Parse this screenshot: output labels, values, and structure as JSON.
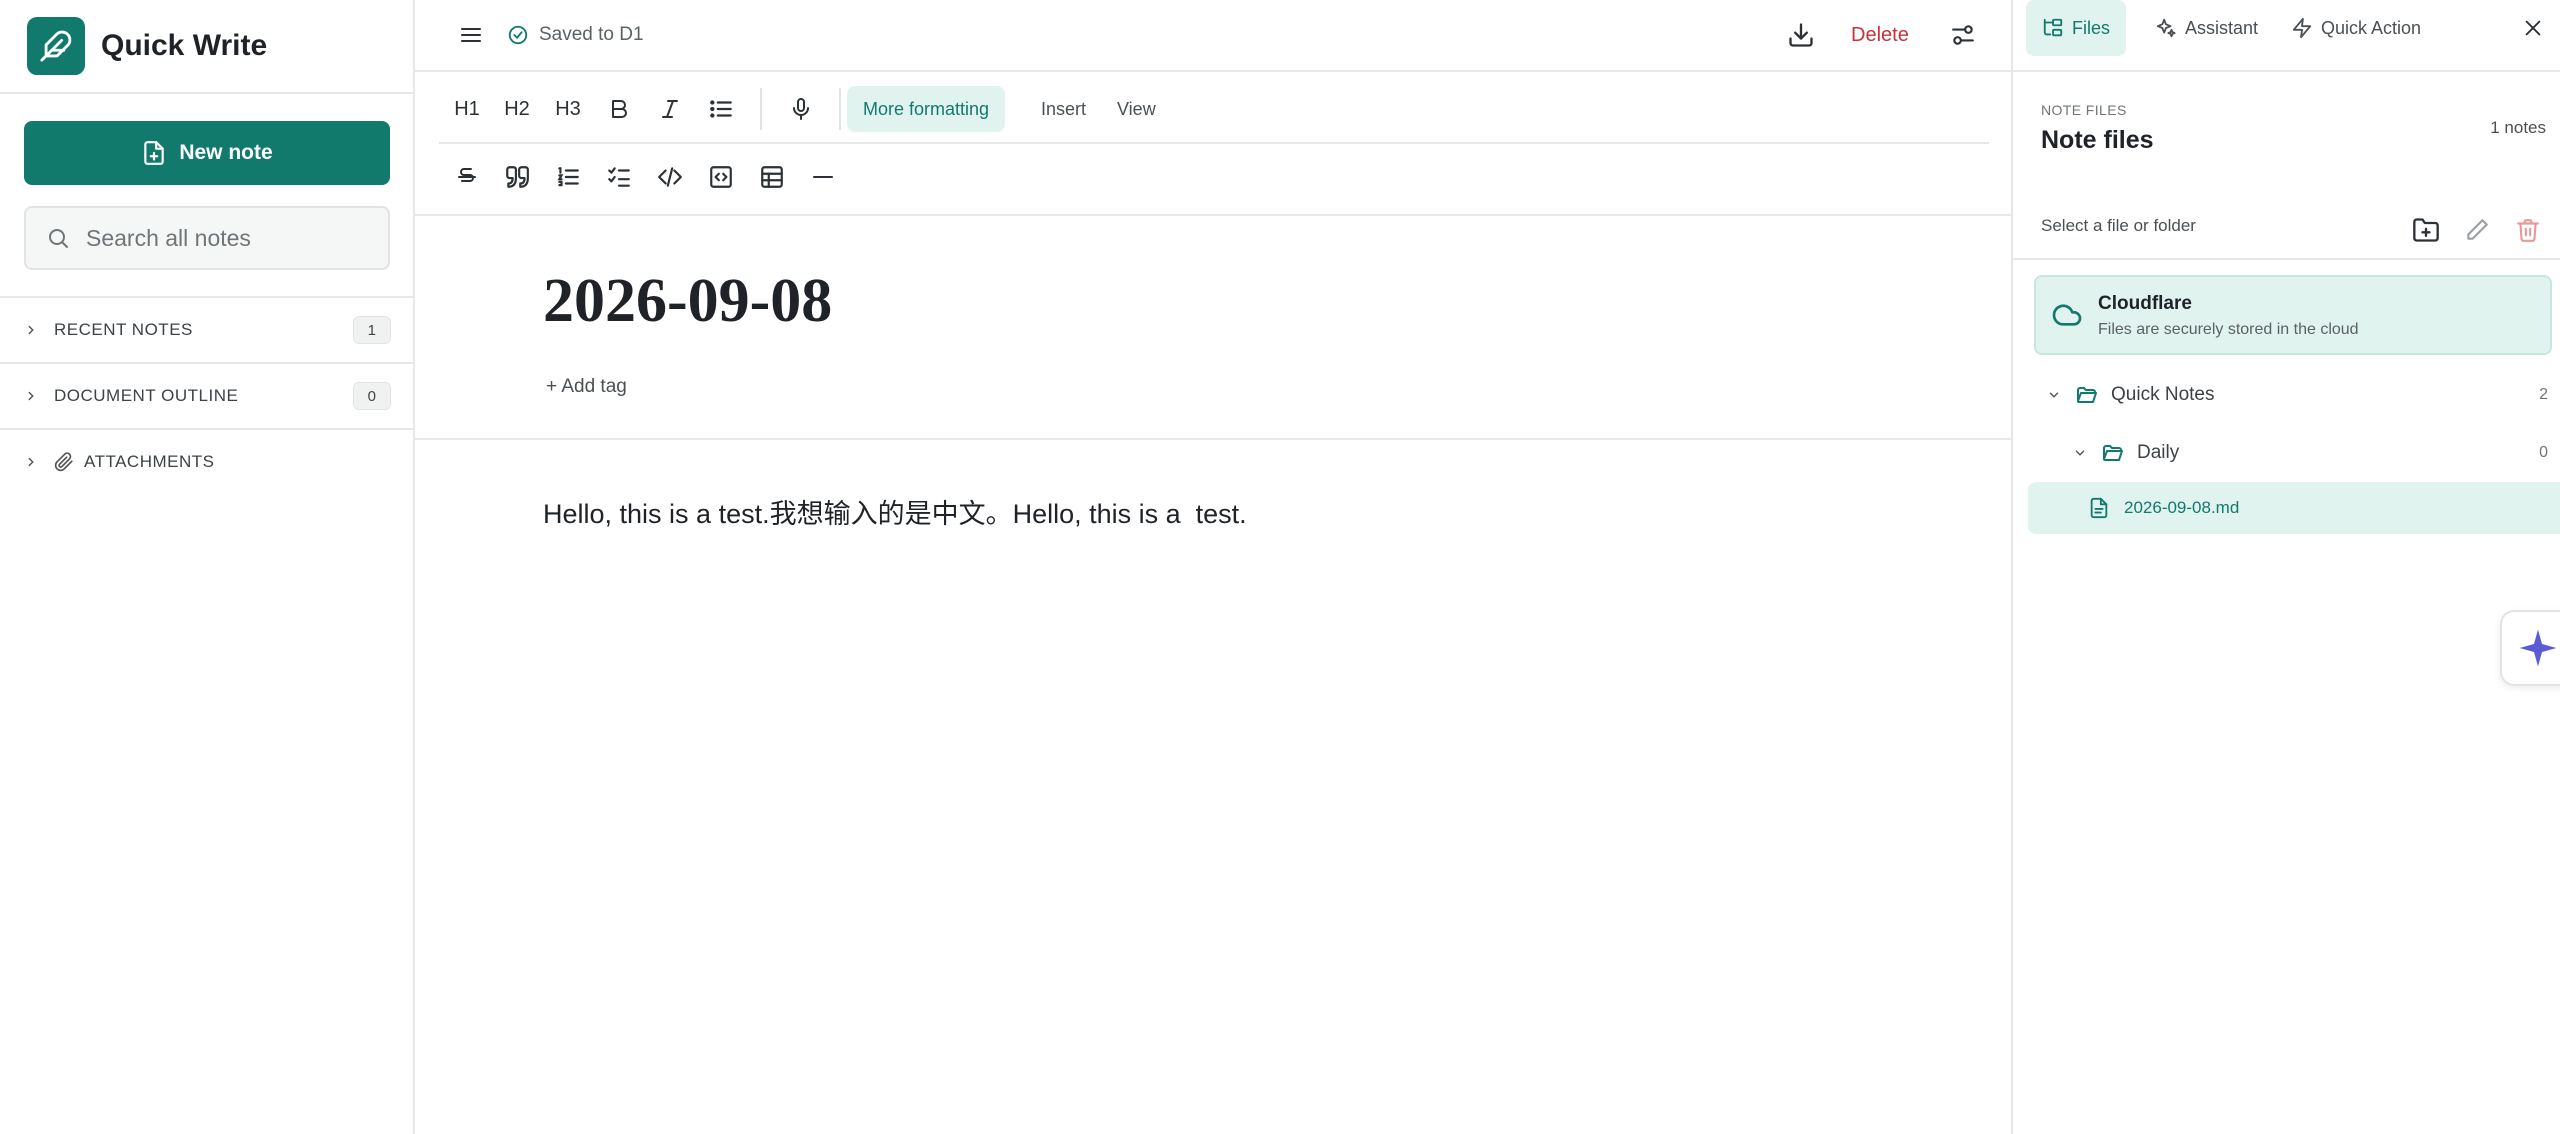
{
  "app": {
    "title": "Quick Write"
  },
  "sidebar": {
    "new_note_label": "New note",
    "search_placeholder": "Search all notes",
    "sections": [
      {
        "label": "RECENT NOTES",
        "count": "1"
      },
      {
        "label": "DOCUMENT OUTLINE",
        "count": "0"
      },
      {
        "label": "ATTACHMENTS"
      }
    ]
  },
  "topbar": {
    "status": "Saved to D1",
    "delete_label": "Delete"
  },
  "toolbar": {
    "h1": "H1",
    "h2": "H2",
    "h3": "H3",
    "tabs": [
      "More formatting",
      "Insert",
      "View"
    ]
  },
  "document": {
    "title": "2026-09-08",
    "add_tag": "+ Add tag",
    "body": "Hello, this is a test.我想输入的是中文。Hello, this is a  test."
  },
  "right_panel": {
    "tabs": [
      "Files",
      "Assistant",
      "Quick Action"
    ],
    "section_label": "NOTE FILES",
    "title": "Note files",
    "count": "1 notes",
    "select_hint": "Select a file or folder",
    "storage": {
      "title": "Cloudflare",
      "subtitle": "Files are securely stored in the cloud"
    },
    "tree": [
      {
        "name": "Quick Notes",
        "count": "2"
      },
      {
        "name": "Daily",
        "count": "0"
      },
      {
        "name": "2026-09-08.md"
      }
    ]
  },
  "colors": {
    "accent": "#127a6d",
    "accent_light": "#e1f3ef",
    "danger": "#c8323a",
    "ai": "#5b5bd6"
  }
}
